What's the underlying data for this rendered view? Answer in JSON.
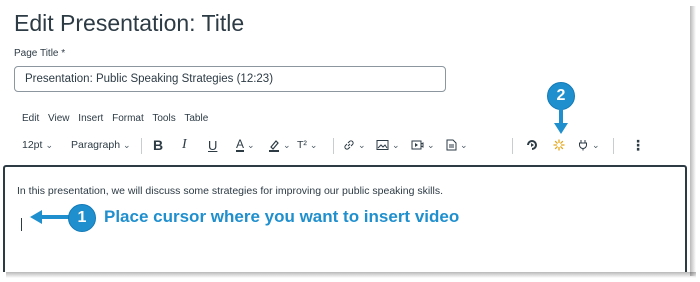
{
  "page": {
    "heading": "Edit Presentation: Title",
    "field_label": "Page Title",
    "required_mark": "*",
    "title_value": "Presentation: Public Speaking Strategies (12:23)"
  },
  "menubar": [
    "Edit",
    "View",
    "Insert",
    "Format",
    "Tools",
    "Table"
  ],
  "toolbar": {
    "font_size": "12pt",
    "block_format": "Paragraph",
    "bold": "B",
    "italic": "I",
    "underline": "U",
    "text_color": "A",
    "superscript": "T²",
    "more": "⋮",
    "icons": [
      "link-icon",
      "image-icon",
      "media-icon",
      "document-icon",
      "apps-icon",
      "lti-tool-icon",
      "plugin-icon"
    ]
  },
  "editor": {
    "text": "In this presentation, we will discuss some strategies for improving our public speaking skills."
  },
  "callouts": {
    "one_number": "1",
    "one_text": "Place cursor where you want to insert video",
    "two_number": "2"
  },
  "colors": {
    "callout_blue": "#1f8fce",
    "text": "#2d3b45",
    "border": "#8b969e",
    "sparkle_icon": "#e6a81c"
  }
}
